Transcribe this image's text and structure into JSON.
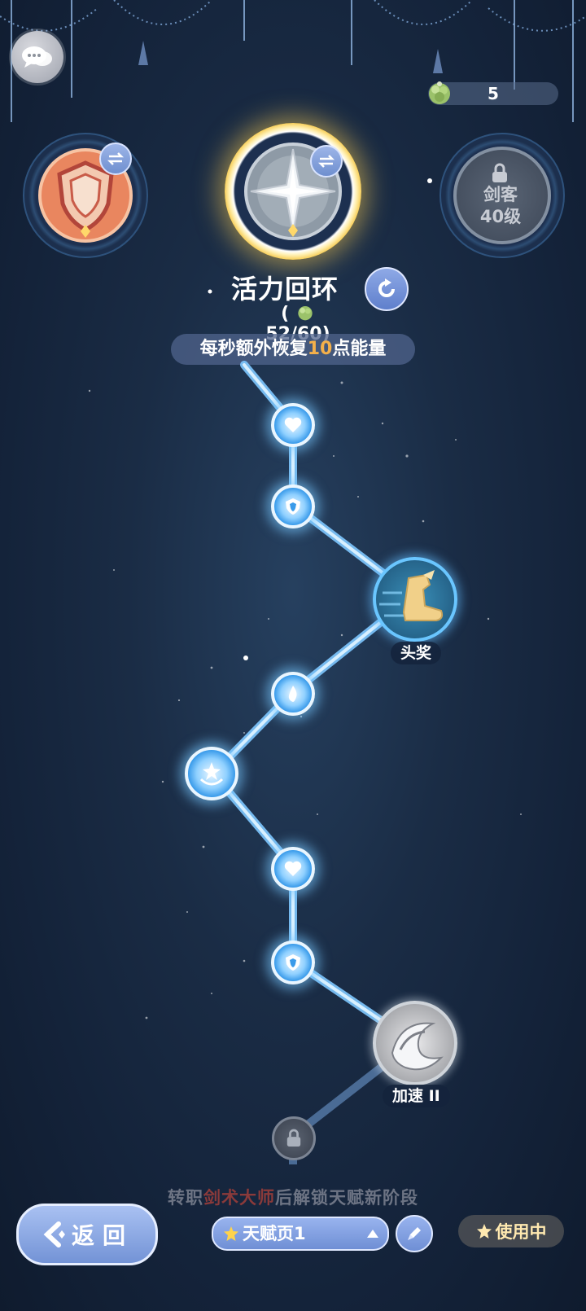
{
  "header": {
    "resource_count": "5"
  },
  "skills": {
    "locked_slot": {
      "line1": "剑客",
      "line2": "40级"
    }
  },
  "talent": {
    "title": "活力回环",
    "cost_open": "(",
    "cost_value": "52/60",
    "cost_close": ")",
    "desc_prefix": "每秒额外恢复",
    "desc_value": "10",
    "desc_suffix": "点能量"
  },
  "path_nodes": {
    "medal_1_label": "头奖",
    "medal_2_label": "加速 II"
  },
  "hint": {
    "prefix": "转职",
    "highlight": "剑术大师",
    "suffix": "后解锁天赋新阶段"
  },
  "bottom": {
    "back_label": "返回",
    "page_select_label": "天赋页1",
    "inuse_label": "使用中"
  },
  "colors": {
    "accent_blue": "#6f8fd5",
    "highlight_orange": "#f4b04a",
    "gold": "#f5c542"
  }
}
